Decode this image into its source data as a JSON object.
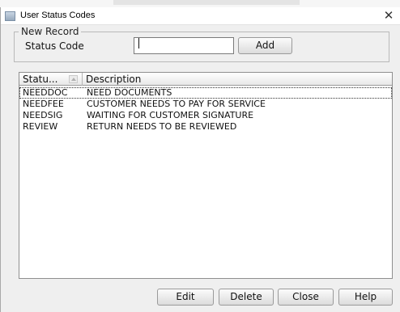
{
  "window": {
    "title": "User Status Codes"
  },
  "new_record": {
    "legend": "New Record",
    "status_code_label": "Status Code",
    "status_code_value": "",
    "add_label": "Add"
  },
  "table": {
    "headers": {
      "status": "Statu...",
      "description": "Description"
    },
    "rows": [
      {
        "code": "NEEDDOC",
        "description": "NEED DOCUMENTS"
      },
      {
        "code": "NEEDFEE",
        "description": "CUSTOMER NEEDS TO PAY FOR SERVICE"
      },
      {
        "code": "NEEDSIG",
        "description": "WAITING FOR CUSTOMER SIGNATURE"
      },
      {
        "code": "REVIEW",
        "description": "RETURN NEEDS TO BE REVIEWED"
      }
    ]
  },
  "footer": {
    "edit_label": "Edit",
    "delete_label": "Delete",
    "close_label": "Close",
    "help_label": "Help"
  }
}
